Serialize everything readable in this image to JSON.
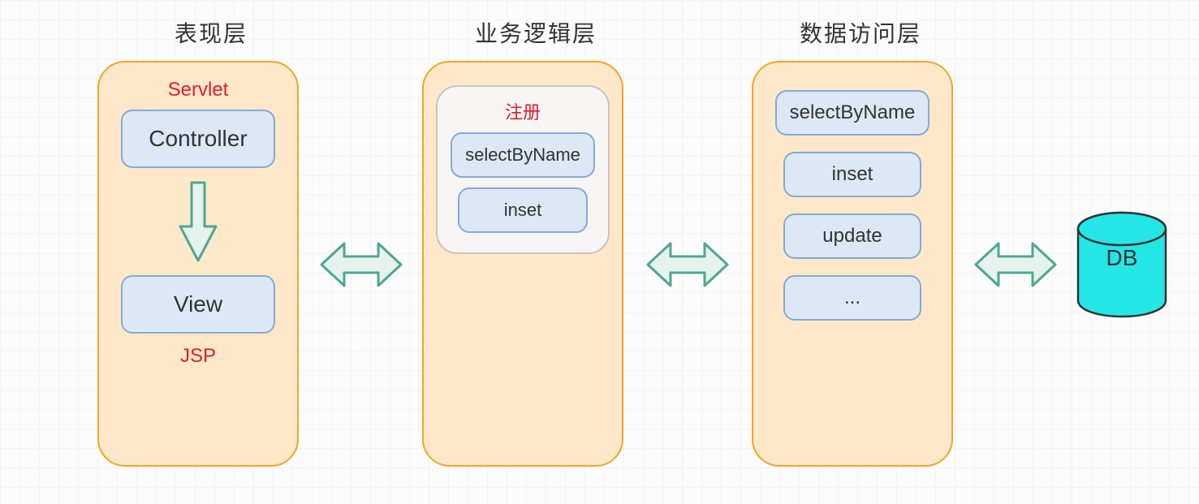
{
  "titles": {
    "presentation": "表现层",
    "business": "业务逻辑层",
    "data": "数据访问层"
  },
  "presentation": {
    "servlet": "Servlet",
    "controller": "Controller",
    "view": "View",
    "jsp": "JSP"
  },
  "business": {
    "register": "注册",
    "selectByName": "selectByName",
    "inset": "inset"
  },
  "dataAccess": {
    "selectByName": "selectByName",
    "inset": "inset",
    "update": "update",
    "more": "..."
  },
  "db": {
    "label": "DB"
  },
  "colors": {
    "layerFill": "#FFE8C9",
    "layerBorder": "#F5A524",
    "pillFill": "#DCE8F6",
    "pillBorder": "#87A9D3",
    "accentRed": "#E11D2E",
    "arrowStroke": "#4FA690",
    "arrowFill": "#E6F2ED",
    "dbFill": "#24E6E6",
    "dbStroke": "#333333"
  }
}
